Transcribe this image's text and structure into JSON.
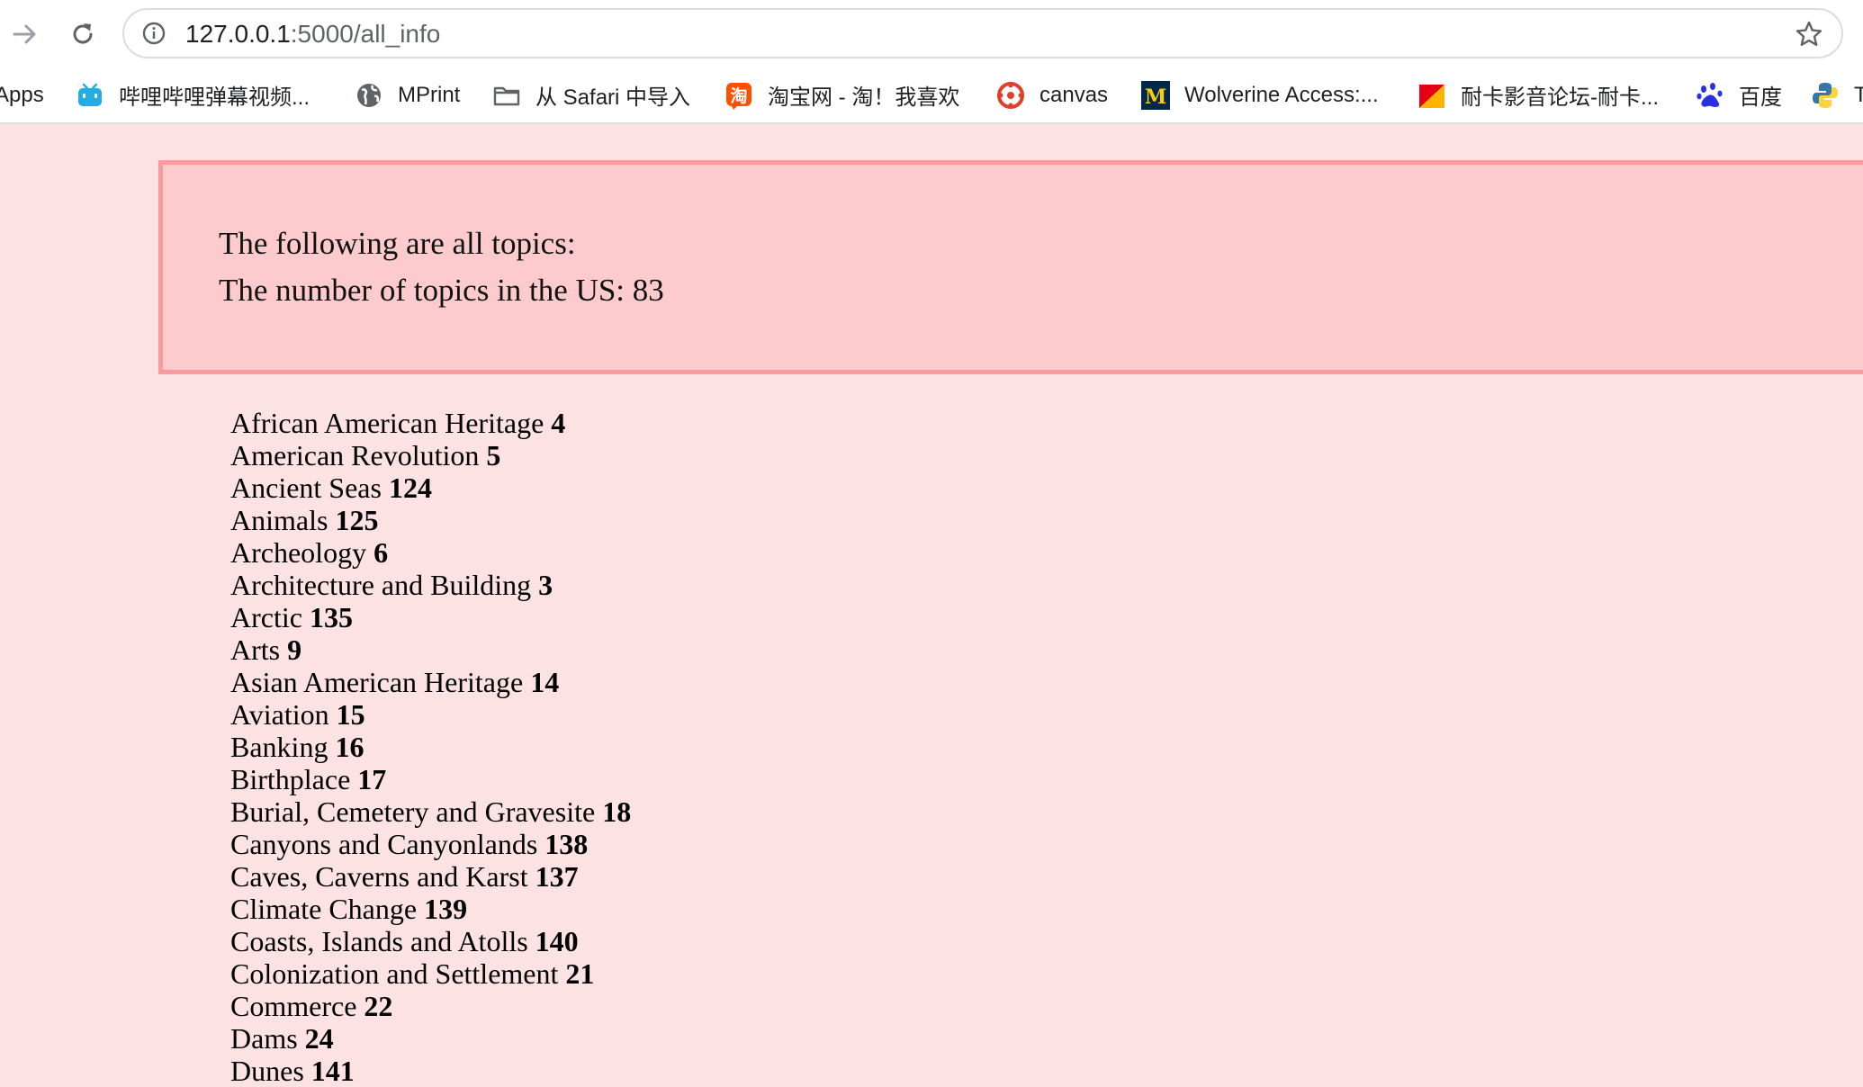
{
  "browser": {
    "url_host": "127.0.0.1",
    "url_path": ":5000/all_info",
    "bookmarks": [
      {
        "label": "Apps",
        "icon": "apps-icon"
      },
      {
        "label": "哔哩哔哩弹幕视频...",
        "icon": "bilibili-icon"
      },
      {
        "label": "MPrint",
        "icon": "globe-icon"
      },
      {
        "label": "从 Safari 中导入",
        "icon": "folder-icon"
      },
      {
        "label": "淘宝网 - 淘！我喜欢",
        "icon": "taobao-icon"
      },
      {
        "label": "canvas",
        "icon": "canvas-icon"
      },
      {
        "label": "Wolverine Access:...",
        "icon": "umich-icon"
      },
      {
        "label": "耐卡影音论坛-耐卡...",
        "icon": "naika-icon"
      },
      {
        "label": "百度",
        "icon": "baidu-icon"
      },
      {
        "label": "T",
        "icon": "python-icon"
      }
    ]
  },
  "header": {
    "line1": "The following are all topics:",
    "line2": "The number of topics in the US: 83"
  },
  "topics": [
    {
      "name": "African American Heritage",
      "count": "4"
    },
    {
      "name": "American Revolution",
      "count": "5"
    },
    {
      "name": "Ancient Seas",
      "count": "124"
    },
    {
      "name": "Animals",
      "count": "125"
    },
    {
      "name": "Archeology",
      "count": "6"
    },
    {
      "name": "Architecture and Building",
      "count": "3"
    },
    {
      "name": "Arctic",
      "count": "135"
    },
    {
      "name": "Arts",
      "count": "9"
    },
    {
      "name": "Asian American Heritage",
      "count": "14"
    },
    {
      "name": "Aviation",
      "count": "15"
    },
    {
      "name": "Banking",
      "count": "16"
    },
    {
      "name": "Birthplace",
      "count": "17"
    },
    {
      "name": "Burial, Cemetery and Gravesite",
      "count": "18"
    },
    {
      "name": "Canyons and Canyonlands",
      "count": "138"
    },
    {
      "name": "Caves, Caverns and Karst",
      "count": "137"
    },
    {
      "name": "Climate Change",
      "count": "139"
    },
    {
      "name": "Coasts, Islands and Atolls",
      "count": "140"
    },
    {
      "name": "Colonization and Settlement",
      "count": "21"
    },
    {
      "name": "Commerce",
      "count": "22"
    },
    {
      "name": "Dams",
      "count": "24"
    },
    {
      "name": "Dunes",
      "count": "141"
    }
  ]
}
